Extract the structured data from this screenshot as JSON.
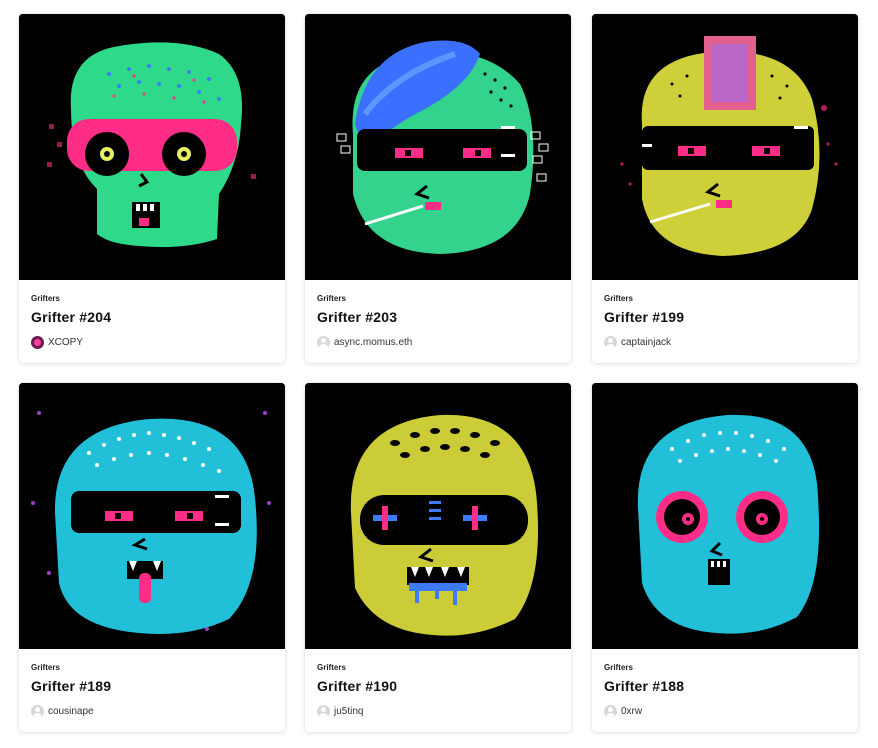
{
  "items": [
    {
      "collection": "Grifters",
      "title": "Grifter #204",
      "owner": "XCOPY",
      "owner_avatar": "custom-avatar-icon",
      "image_alt": "Grifter #204 artwork",
      "colors": {
        "face": "#2fd98a",
        "accent": "#ff2d86",
        "bg": "#000000",
        "eye": "#e8f060"
      }
    },
    {
      "collection": "Grifters",
      "title": "Grifter #203",
      "owner": "async.momus.eth",
      "owner_avatar": "default-user-icon",
      "image_alt": "Grifter #203 artwork",
      "colors": {
        "face": "#33d38e",
        "accent": "#ff2d86",
        "bg": "#000000",
        "hair": "#3a6fff"
      }
    },
    {
      "collection": "Grifters",
      "title": "Grifter #199",
      "owner": "captainjack",
      "owner_avatar": "default-user-icon",
      "image_alt": "Grifter #199 artwork",
      "colors": {
        "face": "#cfcf3a",
        "accent": "#ff2d86",
        "bg": "#000000",
        "hair": "#e2608f"
      }
    },
    {
      "collection": "Grifters",
      "title": "Grifter #189",
      "owner": "cousinape",
      "owner_avatar": "default-user-icon",
      "image_alt": "Grifter #189 artwork",
      "colors": {
        "face": "#22bfd8",
        "accent": "#ff2d86",
        "bg": "#000000"
      }
    },
    {
      "collection": "Grifters",
      "title": "Grifter #190",
      "owner": "ju5tinq",
      "owner_avatar": "default-user-icon",
      "image_alt": "Grifter #190 artwork",
      "colors": {
        "face": "#cccc38",
        "accent": "#ff2d86",
        "bg": "#000000",
        "eye": "#3d7bff"
      }
    },
    {
      "collection": "Grifters",
      "title": "Grifter #188",
      "owner": "0xrw",
      "owner_avatar": "default-user-icon",
      "image_alt": "Grifter #188 artwork",
      "colors": {
        "face": "#22bfd8",
        "accent": "#ff2d86",
        "bg": "#000000"
      }
    }
  ]
}
